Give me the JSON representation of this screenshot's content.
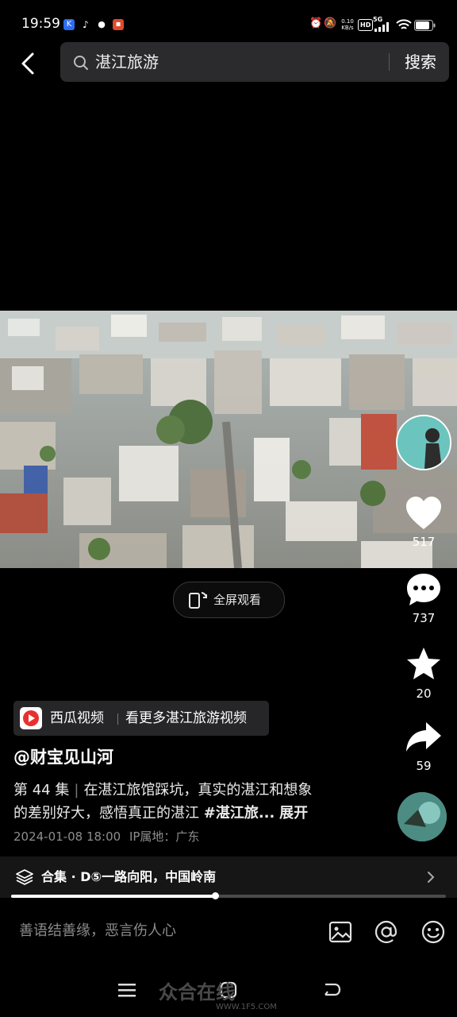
{
  "status_bar": {
    "time": "19:59",
    "network_speed_value": "0.10",
    "network_speed_unit": "KB/s",
    "hd_label": "HD",
    "signal_label": "5G"
  },
  "search": {
    "query": "湛江旅游",
    "button_label": "搜索"
  },
  "fullscreen": {
    "label": "全屏观看"
  },
  "actions": {
    "like_count": "517",
    "comment_count": "737",
    "favorite_count": "20",
    "share_count": "59"
  },
  "source_banner": {
    "app_name": "西瓜视频",
    "link_text": "看更多湛江旅游视频"
  },
  "post": {
    "author": "@财宝见山河",
    "episode": "第 44 集",
    "desc_line1": "在湛江旅馆踩坑，真实的湛江和想象",
    "desc_line2_a": "的差别好大，感悟真正的湛江 ",
    "hashtag": "#湛江旅...",
    "expand_label": "展开",
    "date": "2024-01-08 18:00",
    "ip_location": "IP属地：广东"
  },
  "collection": {
    "prefix": "合集",
    "dot": "·",
    "title": "D⑤一路向阳，中国岭南"
  },
  "playback": {
    "progress": 0.47
  },
  "comment_bar": {
    "placeholder": "善语结善缘，恶言伤人心"
  },
  "watermark": {
    "text": "众合在线",
    "sub": "WWW.1F5.COM"
  }
}
